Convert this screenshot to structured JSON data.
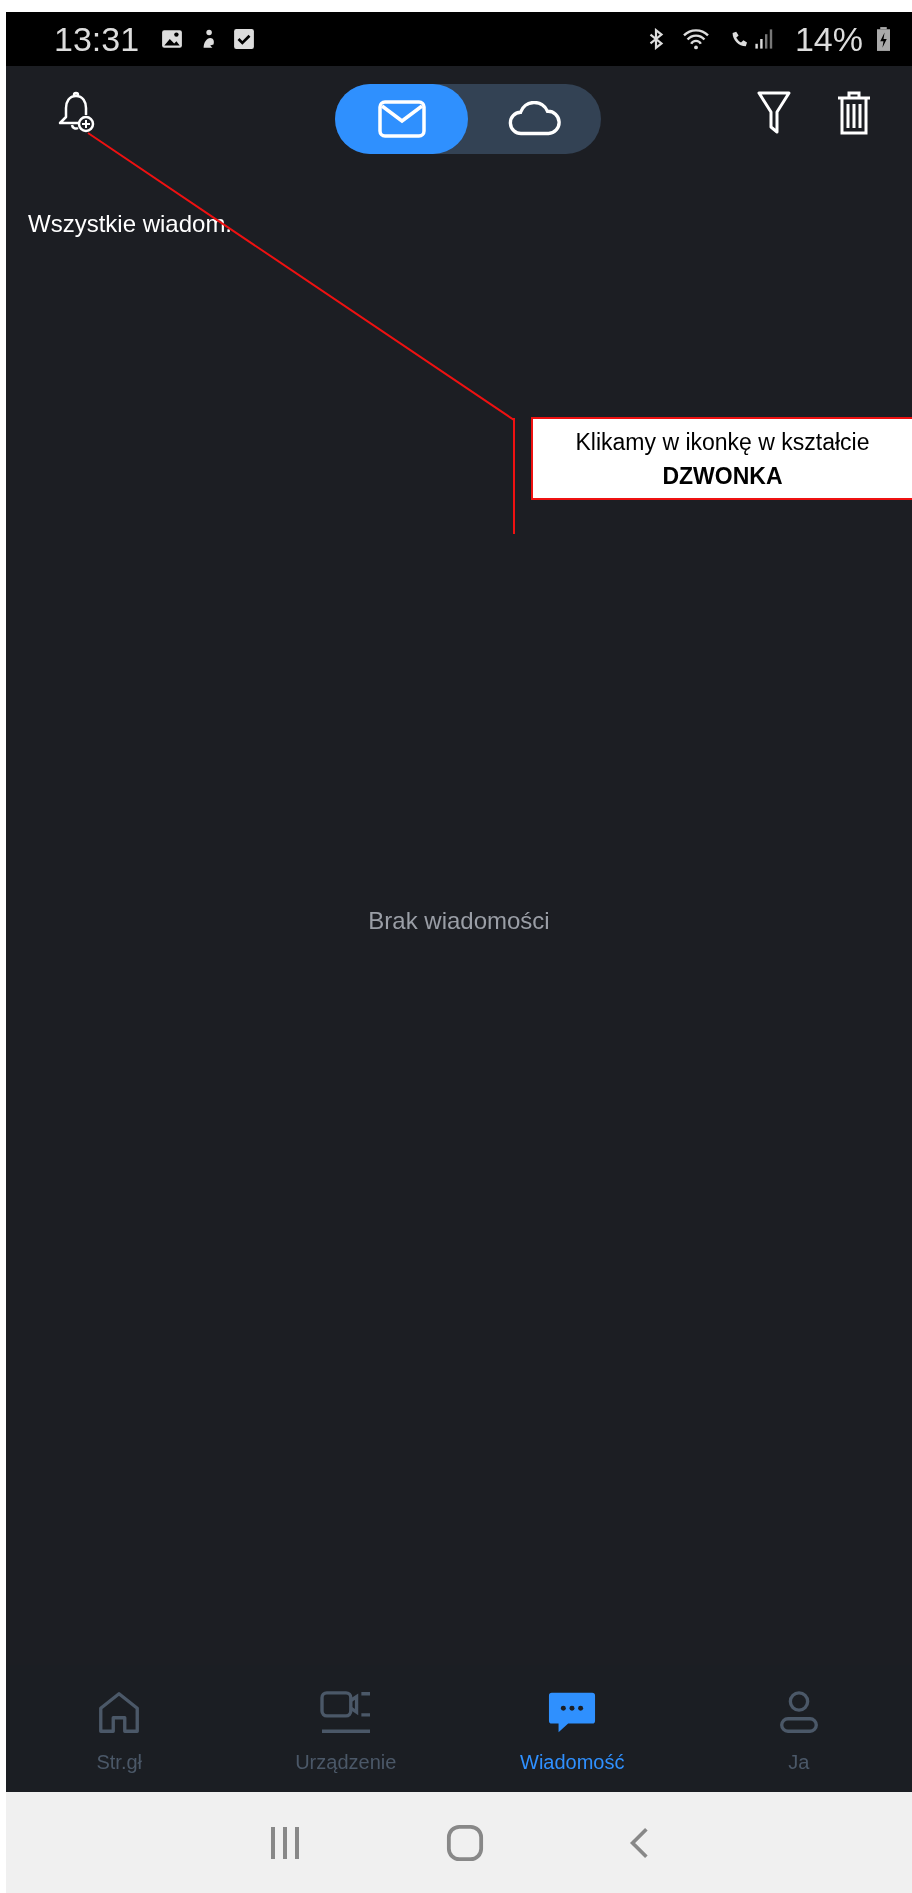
{
  "status_bar": {
    "time": "13:31",
    "battery": "14%"
  },
  "toolbar": {
    "segments": [
      {
        "selected": true
      },
      {
        "selected": false
      }
    ]
  },
  "filter_label": "Wszystkie wiadom.",
  "empty_message": "Brak wiadomości",
  "callout": {
    "text": "Klikamy w ikonkę w kształcie",
    "emphasis": "DZWONKA"
  },
  "bottom_nav": [
    {
      "label": "Str.gł",
      "selected": false
    },
    {
      "label": "Urządzenie",
      "selected": false
    },
    {
      "label": "Wiadomość",
      "selected": true
    },
    {
      "label": "Ja",
      "selected": false
    }
  ]
}
